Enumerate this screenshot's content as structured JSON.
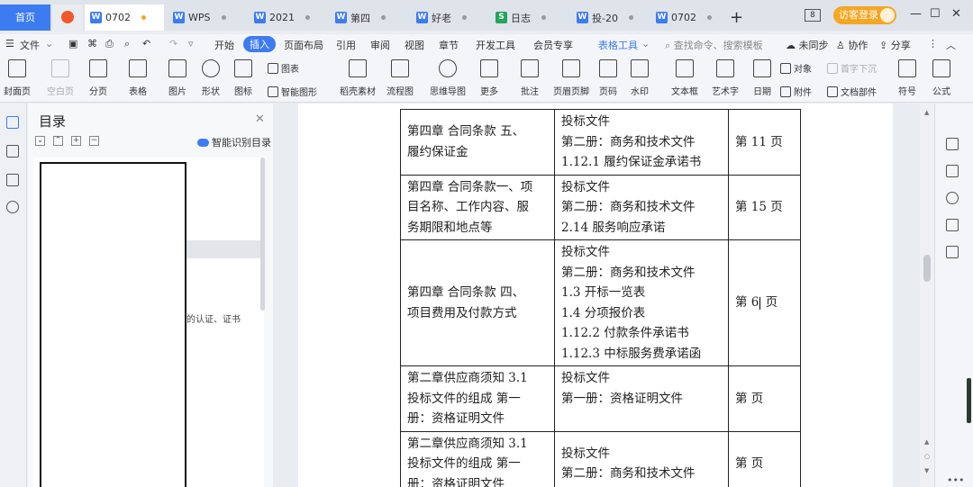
{
  "titlebar": {
    "home": "首页",
    "tabs": [
      {
        "label": "0702",
        "icon": "W"
      },
      {
        "label": "WPS",
        "icon": "W"
      },
      {
        "label": "2021",
        "icon": "W"
      },
      {
        "label": "第四",
        "icon": "W"
      },
      {
        "label": "好老",
        "icon": "W"
      },
      {
        "label": "日志",
        "icon": "S"
      },
      {
        "label": "投-20",
        "icon": "W"
      },
      {
        "label": "0702",
        "icon": "W"
      }
    ],
    "add": "+",
    "badge": "8",
    "login": "访客登录",
    "minimize": "—",
    "maximize": "☐",
    "close": "✕"
  },
  "menubar": {
    "file": "文件",
    "items": [
      "开始",
      "插入",
      "页面布局",
      "引用",
      "审阅",
      "视图",
      "章节",
      "开发工具",
      "会员专享",
      "表格工具"
    ],
    "active": "插入",
    "search": "查找命令、搜索模板",
    "unsync": "未同步",
    "collab": "协作",
    "share": "分享"
  },
  "ribbon": {
    "big": [
      "封面页",
      "空白页",
      "分页",
      "表格",
      "图片",
      "形状",
      "图标",
      "稻壳素材",
      "流程图",
      "思维导图",
      "更多",
      "批注",
      "页眉页脚",
      "页码",
      "水印",
      "文本框",
      "艺术字",
      "日期",
      "符号",
      "公式"
    ],
    "small": [
      "图表",
      "智能图形",
      "对象",
      "首字下沉",
      "附件",
      "文档部件"
    ]
  },
  "toc": {
    "title": "目录",
    "smart": "智能识别目录",
    "partial": "的认证、证书"
  },
  "table": {
    "rows": [
      {
        "c1": [
          "第四章  合同条款  五、",
          "履约保证金"
        ],
        "c2": [
          "投标文件",
          "第二册：商务和技术文件",
          "1.12.1 履约保证金承诺书"
        ],
        "c3": "第 11 页"
      },
      {
        "c1": [
          "第四章  合同条款一、项",
          "目名称、工作内容、服",
          "务期限和地点等"
        ],
        "c2": [
          "投标文件",
          "第二册：商务和技术文件",
          "2.14 服务响应承诺"
        ],
        "c3": "第 15 页"
      },
      {
        "c1": [
          "第四章  合同条款   四、",
          "项目费用及付款方式"
        ],
        "c2": [
          "投标文件",
          "第二册：商务和技术文件",
          "1.3 开标一览表",
          "1.4 分项报价表",
          "1.12.2 付款条件承诺书",
          "1.12.3 中标服务费承诺函"
        ],
        "c3a": "第 6",
        "c3b": " 页"
      },
      {
        "c1": [
          "第二章供应商须知 3.1",
          "投标文件的组成  第一",
          "册：资格证明文件"
        ],
        "c2": [
          "投标文件",
          "第一册：资格证明文件"
        ],
        "c3": "第  页"
      },
      {
        "c1": [
          "第二章供应商须知 3.1",
          "投标文件的组成  第一",
          "册：资格证明文件"
        ],
        "c2": [
          "投标文件",
          "第二册：商务和技术文件"
        ],
        "c3": "第  页"
      }
    ]
  },
  "colors": {
    "accent": "#3d7bf0",
    "login": "#f5a623",
    "wps_red": "#f2572b"
  }
}
